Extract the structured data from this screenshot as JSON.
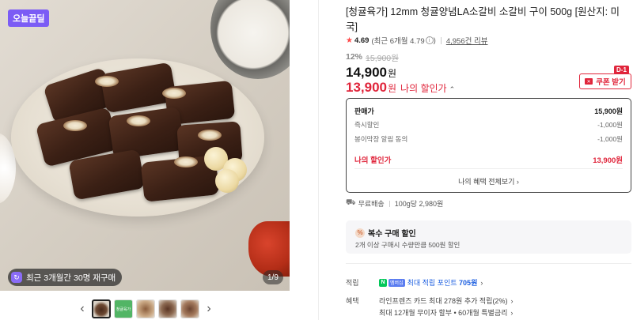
{
  "gallery": {
    "today_badge": "오늘끝딜",
    "restock_text": "최근 3개월간 30명 재구매",
    "counter": "1/9",
    "prev_arrow": "‹",
    "next_arrow": "›",
    "thumb_2_text": "청귤육가"
  },
  "product": {
    "title": "[청귤육가] 12mm 청귤양념LA소갈비 소갈비 구이 500g [원산지: 미국]",
    "rating": "4.69",
    "rating_detail": "(최근 6개월 4.79",
    "rating_detail_end": ")",
    "review_count": "4,956건 리뷰",
    "discount_rate": "12%",
    "original_price": "15,900원",
    "price": "14,900",
    "price_unit": "원",
    "my_price": "13,900",
    "my_price_unit": "원",
    "my_price_label": "나의 할인가",
    "dday": "D-1",
    "coupon_label": "쿠폰 받기"
  },
  "price_box": {
    "rows": [
      {
        "label": "판매가",
        "value": "15,900원"
      },
      {
        "label": "즉시할인",
        "value": "-1,000원"
      },
      {
        "label": "봉이막장 알림 동의",
        "value": "-1,000원"
      }
    ],
    "final_label": "나의 할인가",
    "final_value": "13,900원",
    "link": "나의 혜택 전체보기 ›"
  },
  "shipping": {
    "free": "무료배송",
    "per_unit": "100g당 2,980원"
  },
  "bulk": {
    "title": "복수 구매 할인",
    "desc": "2개 이상 구매시 수량만큼 500원 할인"
  },
  "points": {
    "label": "적립",
    "badge_mem": "멤버십",
    "text_prefix": "최대 적립 포인트",
    "text_value": "705원"
  },
  "benefits": {
    "label": "혜택",
    "line1": "라인프렌즈 카드 최대 278원 추가 적립(2%)",
    "line2": "최대 12개월 무이자 할부 • 60개월 특별금리"
  },
  "colors": {
    "accent_red": "#e0253b",
    "today_badge_purple": "#7b5cf5",
    "point_blue": "#1b5ee0",
    "npay_green": "#03c75a"
  }
}
